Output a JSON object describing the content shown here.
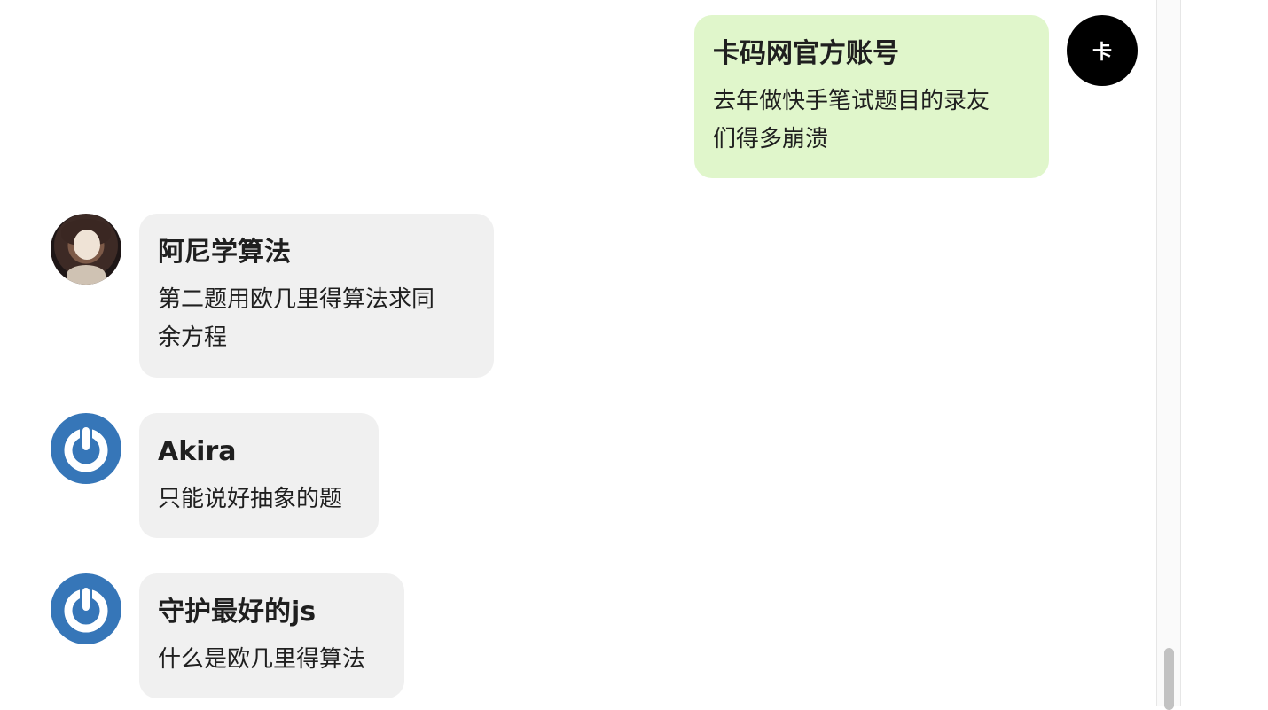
{
  "messages": [
    {
      "side": "right",
      "author": "卡码网官方账号",
      "text_lines": [
        "去年做快手笔试题目的录友",
        "们得多崩溃"
      ],
      "avatar": {
        "icon": "black-avatar-with-character",
        "glyph": "卡"
      }
    },
    {
      "side": "left",
      "author": "阿尼学算法",
      "text_lines": [
        "第二题用欧几里得算法求同",
        "余方程"
      ],
      "avatar": {
        "icon": "anime-photo-avatar"
      }
    },
    {
      "side": "left",
      "author": "Akira",
      "text_lines": [
        "只能说好抽象的题"
      ],
      "avatar": {
        "icon": "power-icon"
      }
    },
    {
      "side": "left",
      "author": "守护最好的js",
      "text_lines": [
        "什么是欧几里得算法"
      ],
      "avatar": {
        "icon": "power-icon"
      }
    }
  ],
  "colors": {
    "own_bubble": "#e0f6cb",
    "other_bubble": "#f0f0f0",
    "power_avatar": "#3676b8"
  }
}
